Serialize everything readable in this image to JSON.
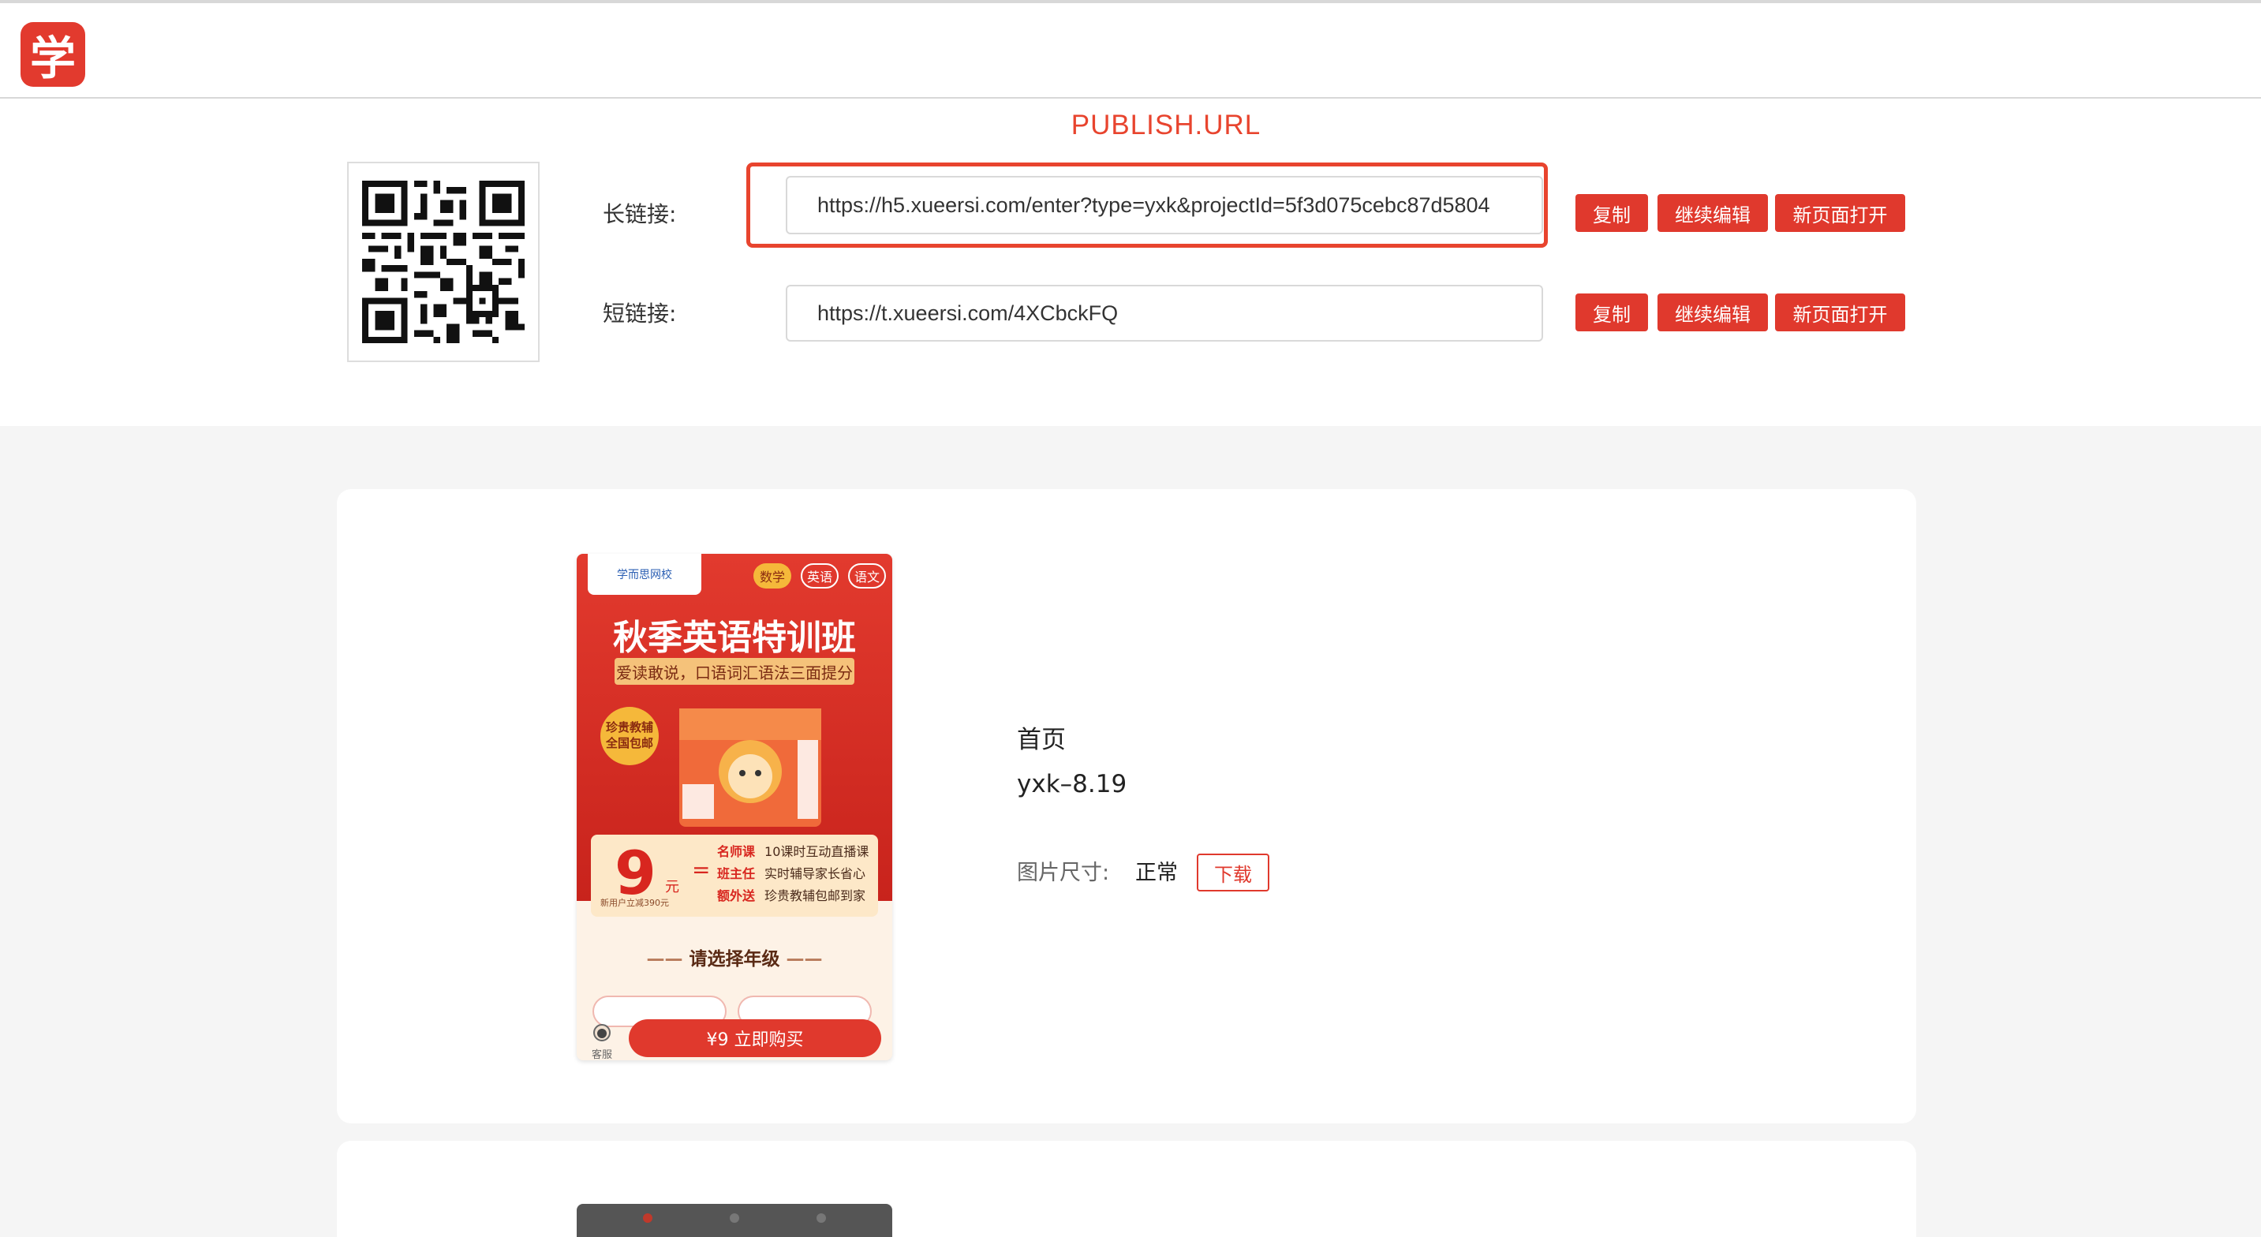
{
  "header": {
    "logo_char": "学"
  },
  "publish": {
    "title": "PUBLISH.URL",
    "long_link": {
      "label": "长链接:",
      "value": "https://h5.xueersi.com/enter?type=yxk&projectId=5f3d075cebc87d5804"
    },
    "short_link": {
      "label": "短链接:",
      "value": "https://t.xueersi.com/4XCbckFQ"
    },
    "buttons": {
      "copy": "复制",
      "continue_edit": "继续编辑",
      "open_new_page": "新页面打开"
    }
  },
  "page_card": {
    "poster": {
      "brand": "学而思网校",
      "subjects": [
        "数学",
        "英语",
        "语文"
      ],
      "title": "秋季英语特训班",
      "subtitle": "爱读敢说，口语词汇语法三面提分",
      "badge": [
        "珍贵教辅",
        "全国包邮"
      ],
      "price": "9",
      "price_unit": "元",
      "price_note": "新用户立减390元",
      "equals": "=",
      "benefits": [
        {
          "key": "名师课",
          "value": "10课时互动直播课"
        },
        {
          "key": "班主任",
          "value": "实时辅导家长省心"
        },
        {
          "key": "额外送",
          "value": "珍贵教辅包邮到家"
        }
      ],
      "grade_title": "请选择年级",
      "service_label": "客服",
      "buy_label": "¥9 立即购买"
    },
    "page_name": "首页",
    "page_id": "yxk–8.19",
    "image_size_label": "图片尺寸:",
    "image_size_value": "正常",
    "download_label": "下载"
  },
  "colors": {
    "accent": "#e0392d",
    "title_red": "#e8442e",
    "background": "#f5f5f5"
  }
}
